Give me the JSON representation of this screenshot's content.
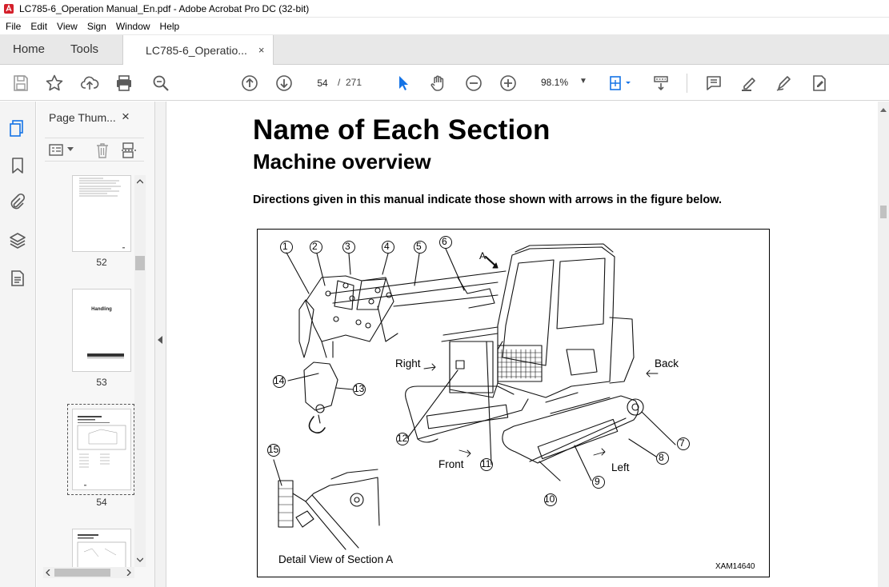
{
  "window": {
    "title": "LC785-6_Operation Manual_En.pdf - Adobe Acrobat Pro DC (32-bit)"
  },
  "menu": [
    "File",
    "Edit",
    "View",
    "Sign",
    "Window",
    "Help"
  ],
  "tabs": {
    "home": "Home",
    "tools": "Tools",
    "document": "LC785-6_Operatio...",
    "close": "×"
  },
  "toolbar": {
    "page_current": "54",
    "page_sep": "/",
    "page_total": "271",
    "zoom": "98.1%",
    "zoom_arrow": "▼"
  },
  "panel": {
    "title": "Page Thum...",
    "close": "×",
    "thumbnails": [
      {
        "label": "52",
        "heading": ""
      },
      {
        "label": "53",
        "heading": "Handling"
      },
      {
        "label": "54",
        "heading": ""
      },
      {
        "label": "",
        "heading": ""
      }
    ]
  },
  "document": {
    "heading": "Name of Each Section",
    "subheading": "Machine overview",
    "paragraph": "Directions given in this manual indicate those shown with arrows in the figure below.",
    "figure": {
      "callouts": [
        "1",
        "2",
        "3",
        "4",
        "5",
        "6",
        "7",
        "8",
        "9",
        "10",
        "11",
        "12",
        "13",
        "14",
        "15"
      ],
      "labels": {
        "a": "A",
        "right": "Right",
        "back": "Back",
        "front": "Front",
        "left": "Left",
        "detail": "Detail View of Section A"
      },
      "code": "XAM14640"
    }
  },
  "colors": {
    "acrobat_red": "#d4202b",
    "icon_gray": "#5a5a5a",
    "pointer_blue": "#1473e6"
  }
}
